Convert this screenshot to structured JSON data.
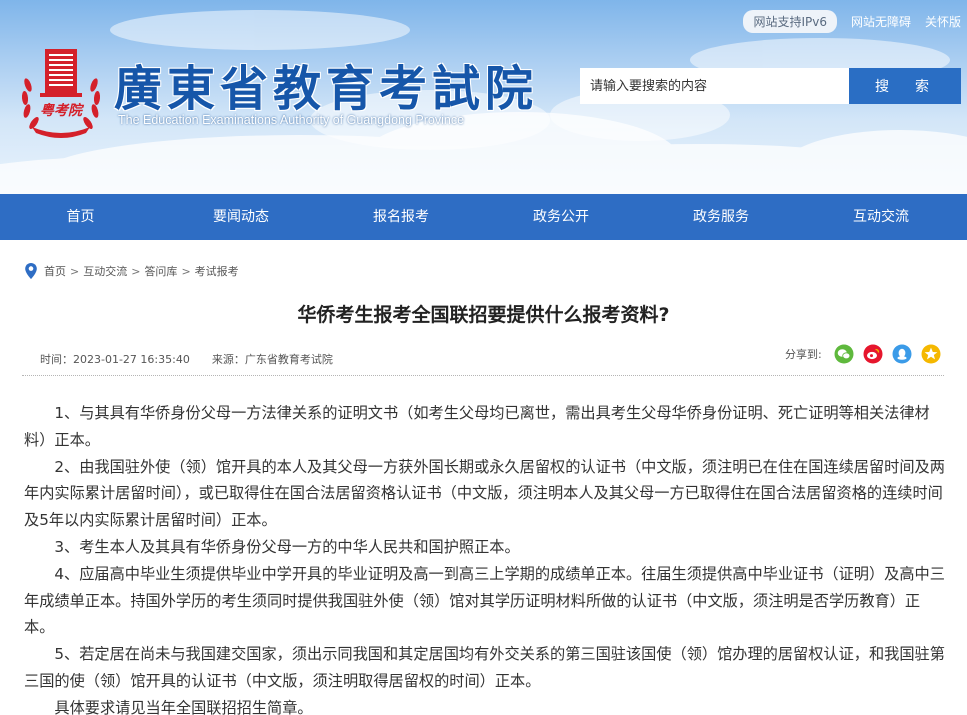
{
  "header": {
    "top_links": {
      "ipv6": "网站支持IPv6",
      "accessible": "网站无障碍",
      "care": "关怀版"
    },
    "emblem_text": "粤考院",
    "title_cn": "廣東省教育考試院",
    "title_en": "The Education Examinations Authority of Guangdong Province",
    "search": {
      "placeholder": "请输入要搜索的内容",
      "button_label": "搜　索"
    }
  },
  "nav": {
    "items": [
      {
        "label": "首页"
      },
      {
        "label": "要闻动态"
      },
      {
        "label": "报名报考"
      },
      {
        "label": "政务公开"
      },
      {
        "label": "政务服务"
      },
      {
        "label": "互动交流"
      }
    ]
  },
  "breadcrumb": {
    "items": [
      "首页",
      "互动交流",
      "答问库",
      "考试报考"
    ],
    "separator": ">"
  },
  "article": {
    "title": "华侨考生报考全国联招要提供什么报考资料?",
    "time": "时间：2023-01-27 16:35:40",
    "source": "来源：广东省教育考试院",
    "share_label": "分享到:",
    "paragraphs": [
      "1、与其具有华侨身份父母一方法律关系的证明文书（如考生父母均已离世，需出具考生父母华侨身份证明、死亡证明等相关法律材料）正本。",
      "2、由我国驻外使（领）馆开具的本人及其父母一方获外国长期或永久居留权的认证书（中文版，须注明已在住在国连续居留时间及两年内实际累计居留时间），或已取得住在国合法居留资格认证书（中文版，须注明本人及其父母一方已取得住在国合法居留资格的连续时间及5年以内实际累计居留时间）正本。",
      "3、考生本人及其具有华侨身份父母一方的中华人民共和国护照正本。",
      "4、应届高中毕业生须提供毕业中学开具的毕业证明及高一到高三上学期的成绩单正本。往届生须提供高中毕业证书（证明）及高中三年成绩单正本。持国外学历的考生须同时提供我国驻外使（领）馆对其学历证明材料所做的认证书（中文版，须注明是否学历教育）正本。",
      "5、若定居在尚未与我国建交国家，须出示同我国和其定居国均有外交关系的第三国驻该国使（领）馆办理的居留权认证，和我国驻第三国的使（领）馆开具的认证书（中文版，须注明取得居留权的时间）正本。",
      "具体要求请见当年全国联招招生简章。"
    ]
  },
  "colors": {
    "brand_blue": "#2e6dc4",
    "title_blue": "#1656a9",
    "emblem_red": "#d4202a",
    "share_wechat": "#5fb93d",
    "share_weibo": "#e6162d",
    "share_qq": "#3b9be8",
    "share_qzone": "#f5b800"
  },
  "icons": {
    "emblem": "institute-emblem",
    "breadcrumb": "location-pin-icon",
    "share": [
      "wechat-icon",
      "weibo-icon",
      "qq-icon",
      "qzone-icon"
    ]
  }
}
